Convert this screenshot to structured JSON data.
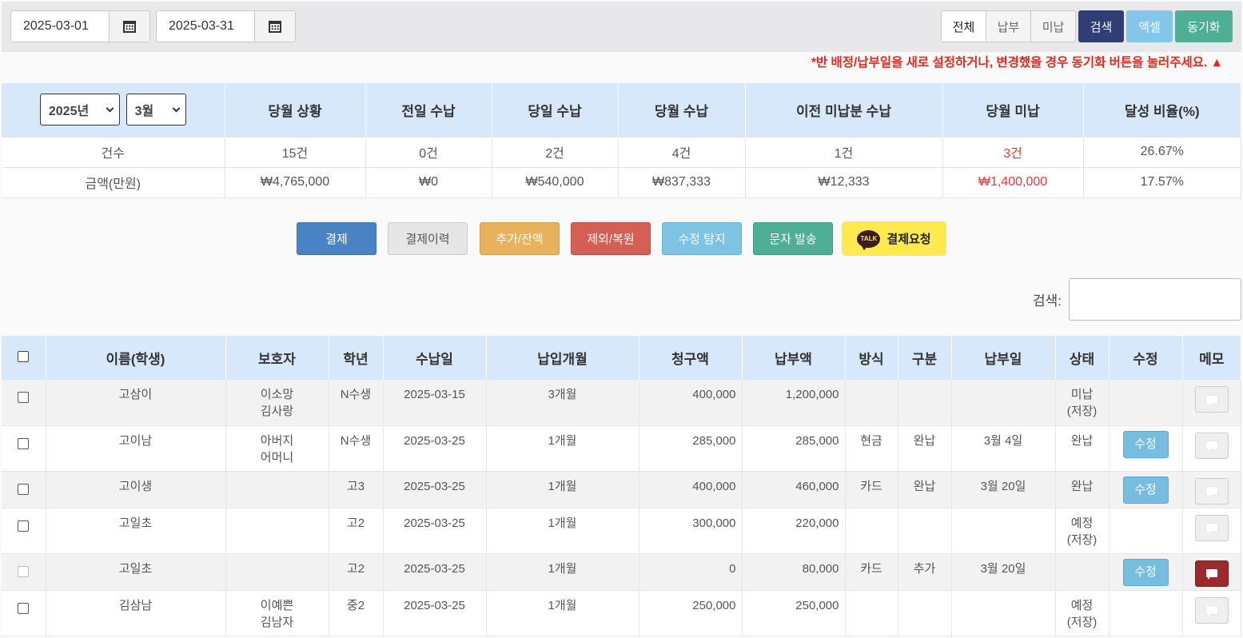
{
  "toolbar": {
    "start_date": "2025-03-01",
    "end_date": "2025-03-31",
    "filters": [
      "전체",
      "납부",
      "미납"
    ],
    "search_label": "검색",
    "excel_label": "액셀",
    "sync_label": "동기화",
    "notice": "*반 배정/납부일을 새로 설정하거나, 변경했을 경우 동기화 버튼을 눌러주세요.  ▲",
    "colors": {
      "search": "#2d3f75",
      "excel": "#84c6ea",
      "sync": "#4fae96"
    }
  },
  "summary": {
    "year_select": "2025년",
    "month_select": "3월",
    "headers": [
      "당월 상황",
      "전일 수납",
      "당일 수납",
      "당월 수납",
      "이전 미납분 수납",
      "당월 미납",
      "달성 비율(%)"
    ],
    "rows": [
      {
        "label": "건수",
        "values": [
          "15건",
          "0건",
          "2건",
          "4건",
          "1건",
          "3건",
          "26.67%"
        ]
      },
      {
        "label": "금액(만원)",
        "values": [
          "₩4,765,000",
          "₩0",
          "₩540,000",
          "₩837,333",
          "₩12,333",
          "₩1,400,000",
          "17.57%"
        ]
      }
    ]
  },
  "actions": {
    "pay": "결제",
    "history": "결제이력",
    "add_balance": "추가/잔액",
    "exclude_restore": "제외/복원",
    "edit_detect": "수정 탐지",
    "send_sms": "문자 발송",
    "kakao_icon_text": "TALK",
    "pay_request": "결제요청",
    "colors": {
      "pay": "#4a83c4",
      "history": "#e6e6e6",
      "add": "#e8b25c",
      "exclude": "#d35f55",
      "detect": "#7ec3e2",
      "sms": "#4fae96",
      "kakao": "#fee94e"
    }
  },
  "search": {
    "label": "검색:",
    "value": ""
  },
  "table": {
    "headers": [
      "이름(학생)",
      "보호자",
      "학년",
      "수납일",
      "납입개월",
      "청구액",
      "납부액",
      "방식",
      "구분",
      "납부일",
      "상태",
      "수정",
      "메모"
    ],
    "edit_label": "수정",
    "rows": [
      {
        "name": "고삼이",
        "guardian": [
          "이소망",
          "김사랑"
        ],
        "grade": "N수생",
        "date": "2025-03-15",
        "months": "3개월",
        "billed": "400,000",
        "paid": "1,200,000",
        "method": "",
        "type": "",
        "pay_day": "",
        "status": [
          "미납",
          "(저장)"
        ],
        "status_color": "red",
        "edit": false,
        "memo_active": false,
        "checkbox_disabled": false
      },
      {
        "name": "고이남",
        "guardian": [
          "아버지",
          "어머니"
        ],
        "grade": "N수생",
        "date": "2025-03-25",
        "months": "1개월",
        "billed": "285,000",
        "paid": "285,000",
        "method": "현금",
        "type": "완납",
        "pay_day": "3월 4일",
        "status": [
          "완납"
        ],
        "status_color": "green",
        "edit": true,
        "memo_active": false,
        "checkbox_disabled": false
      },
      {
        "name": "고이생",
        "guardian": [],
        "grade": "고3",
        "date": "2025-03-25",
        "months": "1개월",
        "billed": "400,000",
        "paid": "460,000",
        "method": "카드",
        "type": "완납",
        "pay_day": "3월 20일",
        "status": [
          "완납"
        ],
        "status_color": "green",
        "edit": true,
        "memo_active": false,
        "checkbox_disabled": false
      },
      {
        "name": "고일초",
        "guardian": [],
        "grade": "고2",
        "date": "2025-03-25",
        "months": "1개월",
        "billed": "300,000",
        "paid": "220,000",
        "method": "",
        "type": "",
        "pay_day": "",
        "status": [
          "예정",
          "(저장)"
        ],
        "status_color": "blue",
        "edit": false,
        "memo_active": false,
        "checkbox_disabled": false
      },
      {
        "name": "고일초",
        "guardian": [],
        "grade": "고2",
        "date": "2025-03-25",
        "months": "1개월",
        "billed": "0",
        "paid": "80,000",
        "method": "카드",
        "type": "추가",
        "pay_day": "3월 20일",
        "status": [],
        "status_color": "",
        "edit": true,
        "memo_active": true,
        "checkbox_disabled": true
      },
      {
        "name": "김삼남",
        "guardian": [
          "이예쁜",
          "김남자"
        ],
        "grade": "중2",
        "date": "2025-03-25",
        "months": "1개월",
        "billed": "250,000",
        "paid": "250,000",
        "method": "",
        "type": "",
        "pay_day": "",
        "status": [
          "예정",
          "(저장)"
        ],
        "status_color": "blue",
        "edit": false,
        "memo_active": false,
        "checkbox_disabled": false
      }
    ]
  }
}
